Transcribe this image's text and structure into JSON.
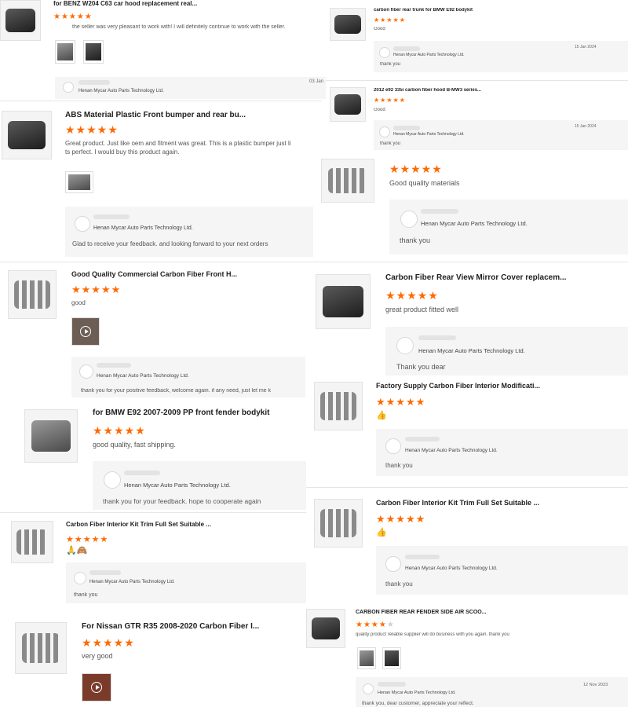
{
  "seller_name": "Henan Mycar Auto Parts Technology Ltd.",
  "star_color": "#ff6a00",
  "reviews": [
    {
      "title": "for BENZ W204 C63 car hood replacement real...",
      "rating": 5,
      "text": "the seller was very pleasant to work with! I will definitely continue to work with the seller.",
      "reply_date": "03 Jan"
    },
    {
      "title": "ABS Material Plastic Front bumper and rear bu...",
      "rating": 5,
      "text": "Great product. Just like oem and fitment was great. This is a plastic bumper just li",
      "text2": "ts perfect. I would buy this product again.",
      "reply_text": "Glad to receive your feedback. and looking forward to your next orders"
    },
    {
      "title": "Good Quality Commercial Carbon Fiber Front H...",
      "rating": 5,
      "text": "good",
      "reply_text": "thank you for your positive feedback, welcome again. if any need, just let me k"
    },
    {
      "title": "for BMW E92 2007-2009 PP front fender bodykit",
      "rating": 5,
      "text": "good quality, fast shipping.",
      "reply_text": "thank you for your feedback. hope to cooperate again"
    },
    {
      "title": "Carbon Fiber Interior Kit Trim Full Set Suitable ...",
      "rating": 5,
      "emoji": "🙏🙈",
      "reply_text": "thank you"
    },
    {
      "title": "For Nissan GTR R35 2008-2020 Carbon Fiber I...",
      "rating": 5,
      "text": "very good"
    },
    {
      "title": "carbon fiber rear trunk for BMW E92 bodykit",
      "rating": 5,
      "text": "Good",
      "reply_date": "15 Jan 2024",
      "reply_text": "thank you"
    },
    {
      "title": "2012 e92 335i carbon fiber hood B-MW3 series...",
      "rating": 5,
      "text": "Good",
      "reply_date": "15 Jan 2024",
      "reply_text": "thank you"
    },
    {
      "rating": 5,
      "text": "Good quality materials",
      "reply_text": "thank you"
    },
    {
      "title": "Carbon Fiber Rear View Mirror Cover replacem...",
      "rating": 5,
      "text": "great product fitted well",
      "reply_text": "Thank you dear"
    },
    {
      "title": "Factory Supply Carbon Fiber Interior Modificati...",
      "rating": 5,
      "emoji": "👍",
      "reply_text": "thank you"
    },
    {
      "title": "Carbon Fiber Interior Kit Trim Full Set Suitable ...",
      "rating": 5,
      "emoji": "👍",
      "reply_text": "thank you"
    },
    {
      "title": "CARBON FIBER REAR FENDER SIDE AIR SCOO...",
      "rating": 4,
      "text": "quality product reliable supplier will do business with you again. thank you",
      "reply_date": "12 Nov 2023",
      "reply_text": "thank you, dear customer, appreciate your reflect."
    }
  ]
}
